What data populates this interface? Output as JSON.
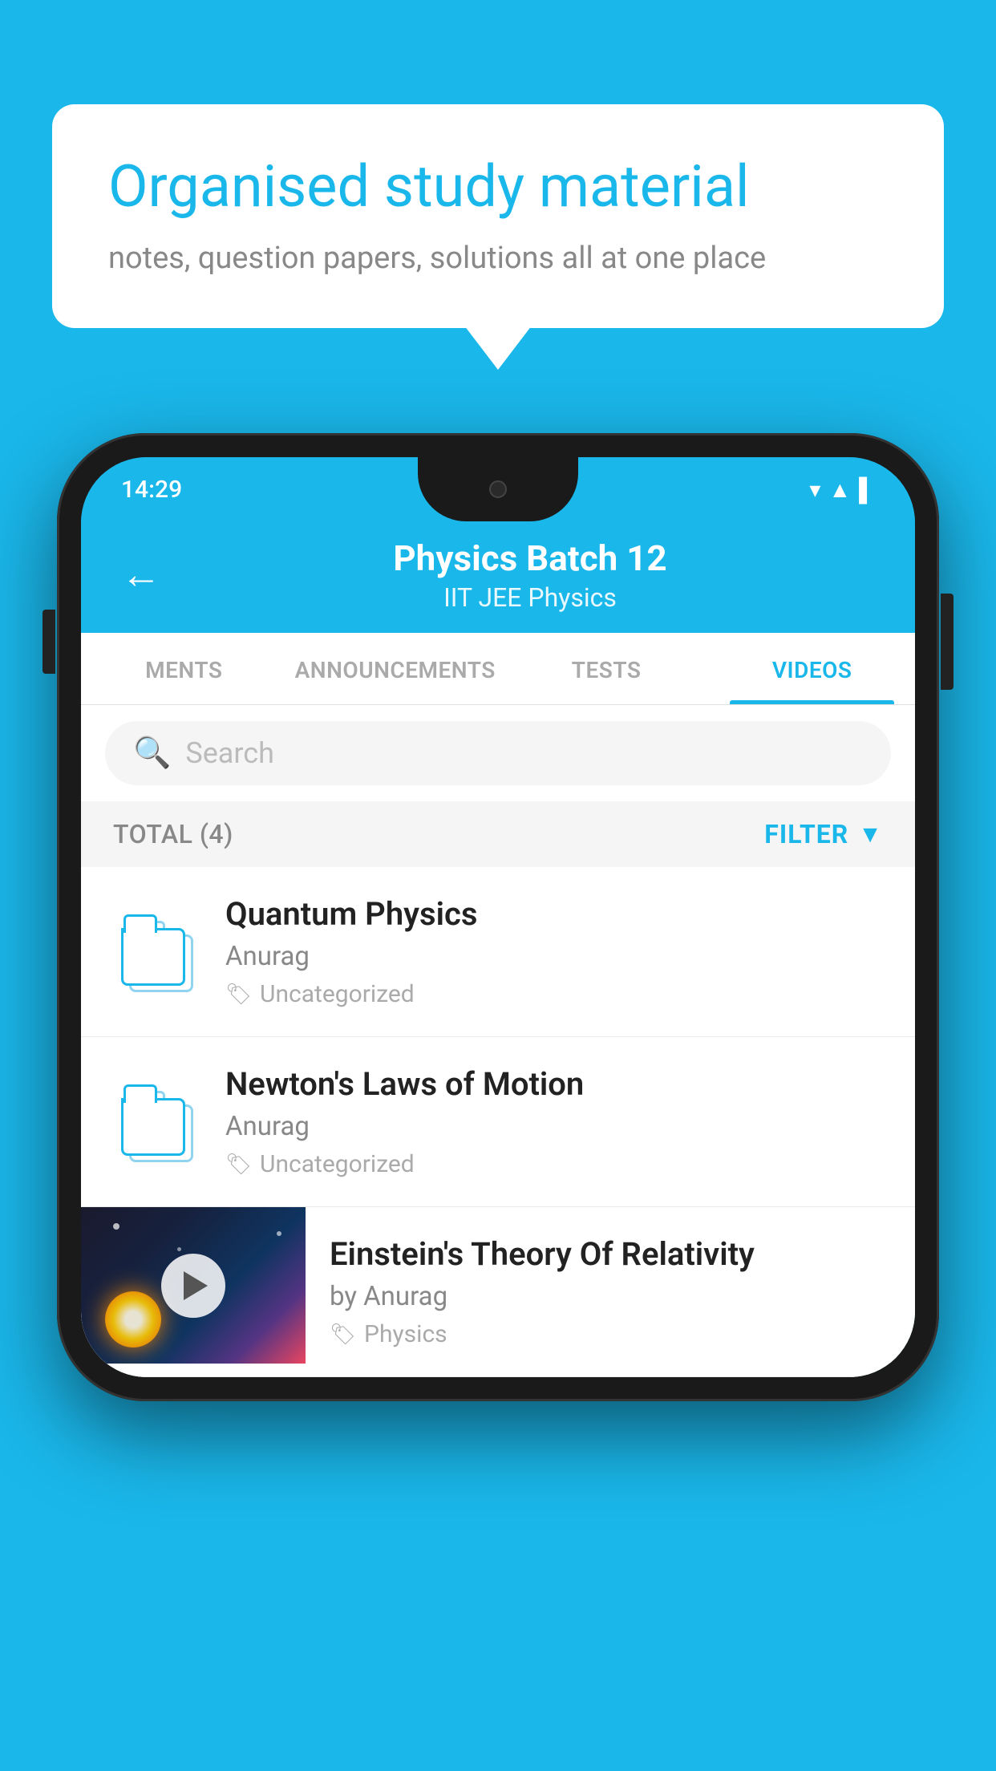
{
  "background": {
    "color": "#1ab7ea"
  },
  "speech_bubble": {
    "title": "Organised study material",
    "subtitle": "notes, question papers, solutions all at one place"
  },
  "phone": {
    "status_bar": {
      "time": "14:29"
    },
    "header": {
      "title": "Physics Batch 12",
      "subtitle": "IIT JEE    Physics",
      "back_label": "←"
    },
    "tabs": [
      {
        "label": "MENTS",
        "active": false
      },
      {
        "label": "ANNOUNCEMENTS",
        "active": false
      },
      {
        "label": "TESTS",
        "active": false
      },
      {
        "label": "VIDEOS",
        "active": true
      }
    ],
    "search": {
      "placeholder": "Search"
    },
    "filter_bar": {
      "total_label": "TOTAL (4)",
      "filter_label": "FILTER"
    },
    "videos": [
      {
        "id": "quantum",
        "title": "Quantum Physics",
        "author": "Anurag",
        "tag": "Uncategorized",
        "has_thumbnail": false
      },
      {
        "id": "newton",
        "title": "Newton's Laws of Motion",
        "author": "Anurag",
        "tag": "Uncategorized",
        "has_thumbnail": false
      },
      {
        "id": "einstein",
        "title": "Einstein's Theory Of Relativity",
        "author": "by Anurag",
        "tag": "Physics",
        "has_thumbnail": true
      }
    ]
  }
}
